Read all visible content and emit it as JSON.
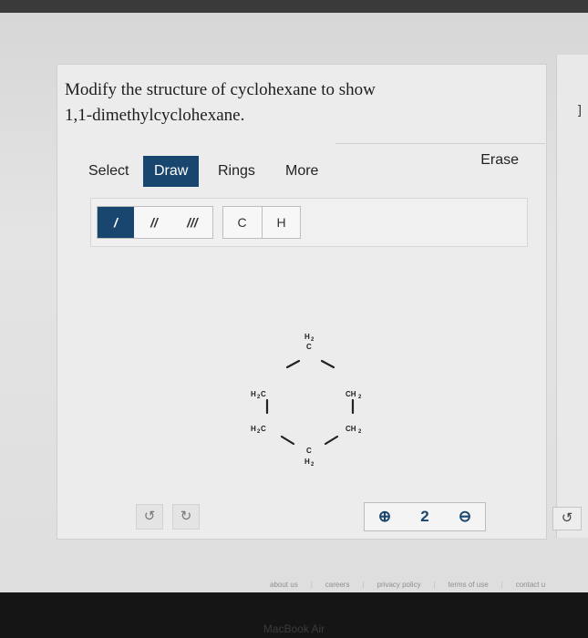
{
  "question": {
    "line1": "Modify the structure of cyclohexane to show",
    "line2": "1,1-dimethylcyclohexane."
  },
  "tabs": {
    "select": "Select",
    "draw": "Draw",
    "rings": "Rings",
    "more": "More",
    "erase": "Erase"
  },
  "bond_tools": {
    "single": "/",
    "double": "//",
    "triple": "///"
  },
  "atom_tools": {
    "c": "C",
    "h": "H"
  },
  "molecule": {
    "top": [
      "H",
      "2",
      "C"
    ],
    "upper_left": [
      "H",
      "2",
      "C"
    ],
    "upper_right": [
      "CH",
      "2"
    ],
    "lower_left": [
      "H",
      "2",
      "C"
    ],
    "lower_right": [
      "CH",
      "2"
    ],
    "bottom": [
      "C",
      "H",
      "2"
    ]
  },
  "controls": {
    "undo_glyph": "↺",
    "redo_glyph": "↻",
    "zoom_in_glyph": "⊕",
    "zoom_reset_glyph": "2",
    "zoom_out_glyph": "⊖"
  },
  "footer": {
    "about": "about us",
    "careers": "careers",
    "privacy": "privacy policy",
    "terms": "terms of use",
    "contact": "contact u"
  },
  "device_label": "MacBook Air",
  "colors": {
    "accent": "#19466e",
    "text": "#1e1e1e",
    "bond": "#222222"
  }
}
